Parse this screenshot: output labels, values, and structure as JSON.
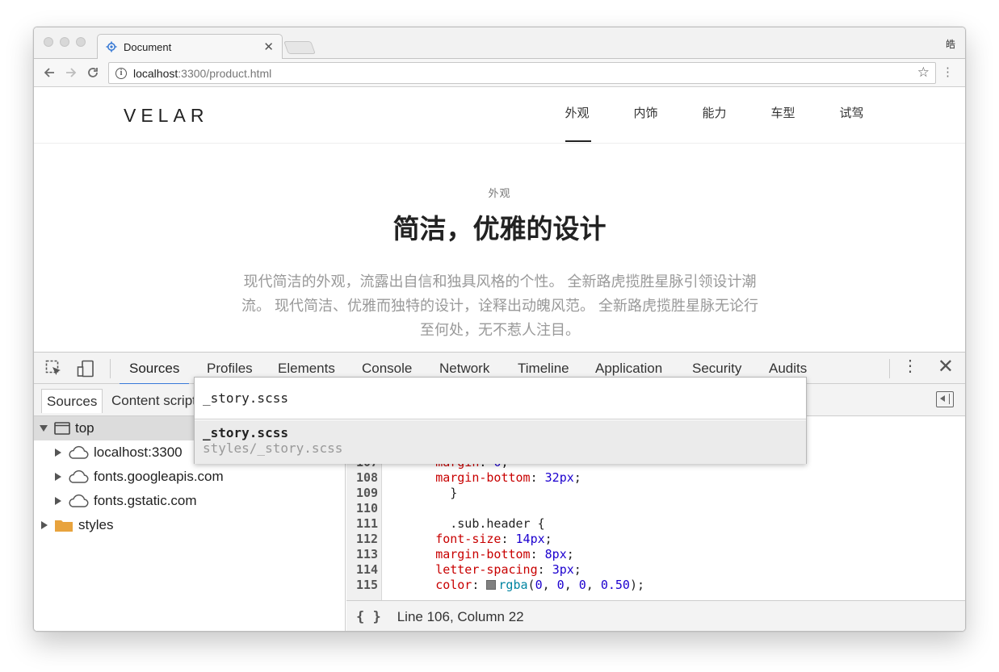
{
  "browser": {
    "tab_title": "Document",
    "tab_close": "✕",
    "profile_initial": "皓",
    "url_host": "localhost",
    "url_path": ":3300/product.html"
  },
  "site": {
    "brand": "VELAR",
    "nav": [
      "外观",
      "内饰",
      "能力",
      "车型",
      "试驾"
    ],
    "eyebrow": "外观",
    "headline": "简洁，优雅的设计",
    "paragraph": "现代简洁的外观，流露出自信和独具风格的个性。 全新路虎揽胜星脉引领设计潮流。 现代简洁、优雅而独特的设计，诠释出动魄风范。 全新路虎揽胜星脉无论行至何处，无不惹人注目。"
  },
  "devtools": {
    "tabs": [
      "Sources",
      "Profiles",
      "Elements",
      "Console",
      "Network",
      "Timeline",
      "Application",
      "Security",
      "Audits"
    ],
    "active_tab": "Sources",
    "navigator_tabs": [
      "Sources",
      "Content scripts"
    ],
    "tree": [
      {
        "label": "top",
        "expanded": true,
        "icon": "frame-icon"
      },
      {
        "label": "localhost:3300",
        "icon": "cloud-icon"
      },
      {
        "label": "fonts.googleapis.com",
        "icon": "cloud-icon"
      },
      {
        "label": "fonts.gstatic.com",
        "icon": "cloud-icon"
      },
      {
        "label": "styles",
        "icon": "folder-icon"
      }
    ],
    "quick_open": {
      "query": "_story.scss",
      "result_title": "_story.scss",
      "result_path": "styles/_story.scss"
    },
    "code": [
      {
        "n": "107",
        "indent": "      ",
        "prop": "margin",
        "val": "0",
        "partial": true
      },
      {
        "n": "108",
        "indent": "      ",
        "prop": "margin-bottom",
        "val": "32px"
      },
      {
        "n": "109",
        "text": "    }"
      },
      {
        "n": "110",
        "text": ""
      },
      {
        "n": "111",
        "text": "    .sub.header {"
      },
      {
        "n": "112",
        "indent": "      ",
        "prop": "font-size",
        "val": "14px"
      },
      {
        "n": "113",
        "indent": "      ",
        "prop": "margin-bottom",
        "val": "8px"
      },
      {
        "n": "114",
        "indent": "      ",
        "prop": "letter-spacing",
        "val": "3px"
      },
      {
        "n": "115",
        "indent": "      ",
        "prop": "color",
        "fn": "rgba",
        "args": [
          "0",
          "0",
          "0",
          "0.50"
        ]
      }
    ],
    "pretty_print": "{ }",
    "status": "Line 106, Column 22"
  },
  "colors": {
    "accent": "#3879d9",
    "folder": "#e8a33d"
  }
}
